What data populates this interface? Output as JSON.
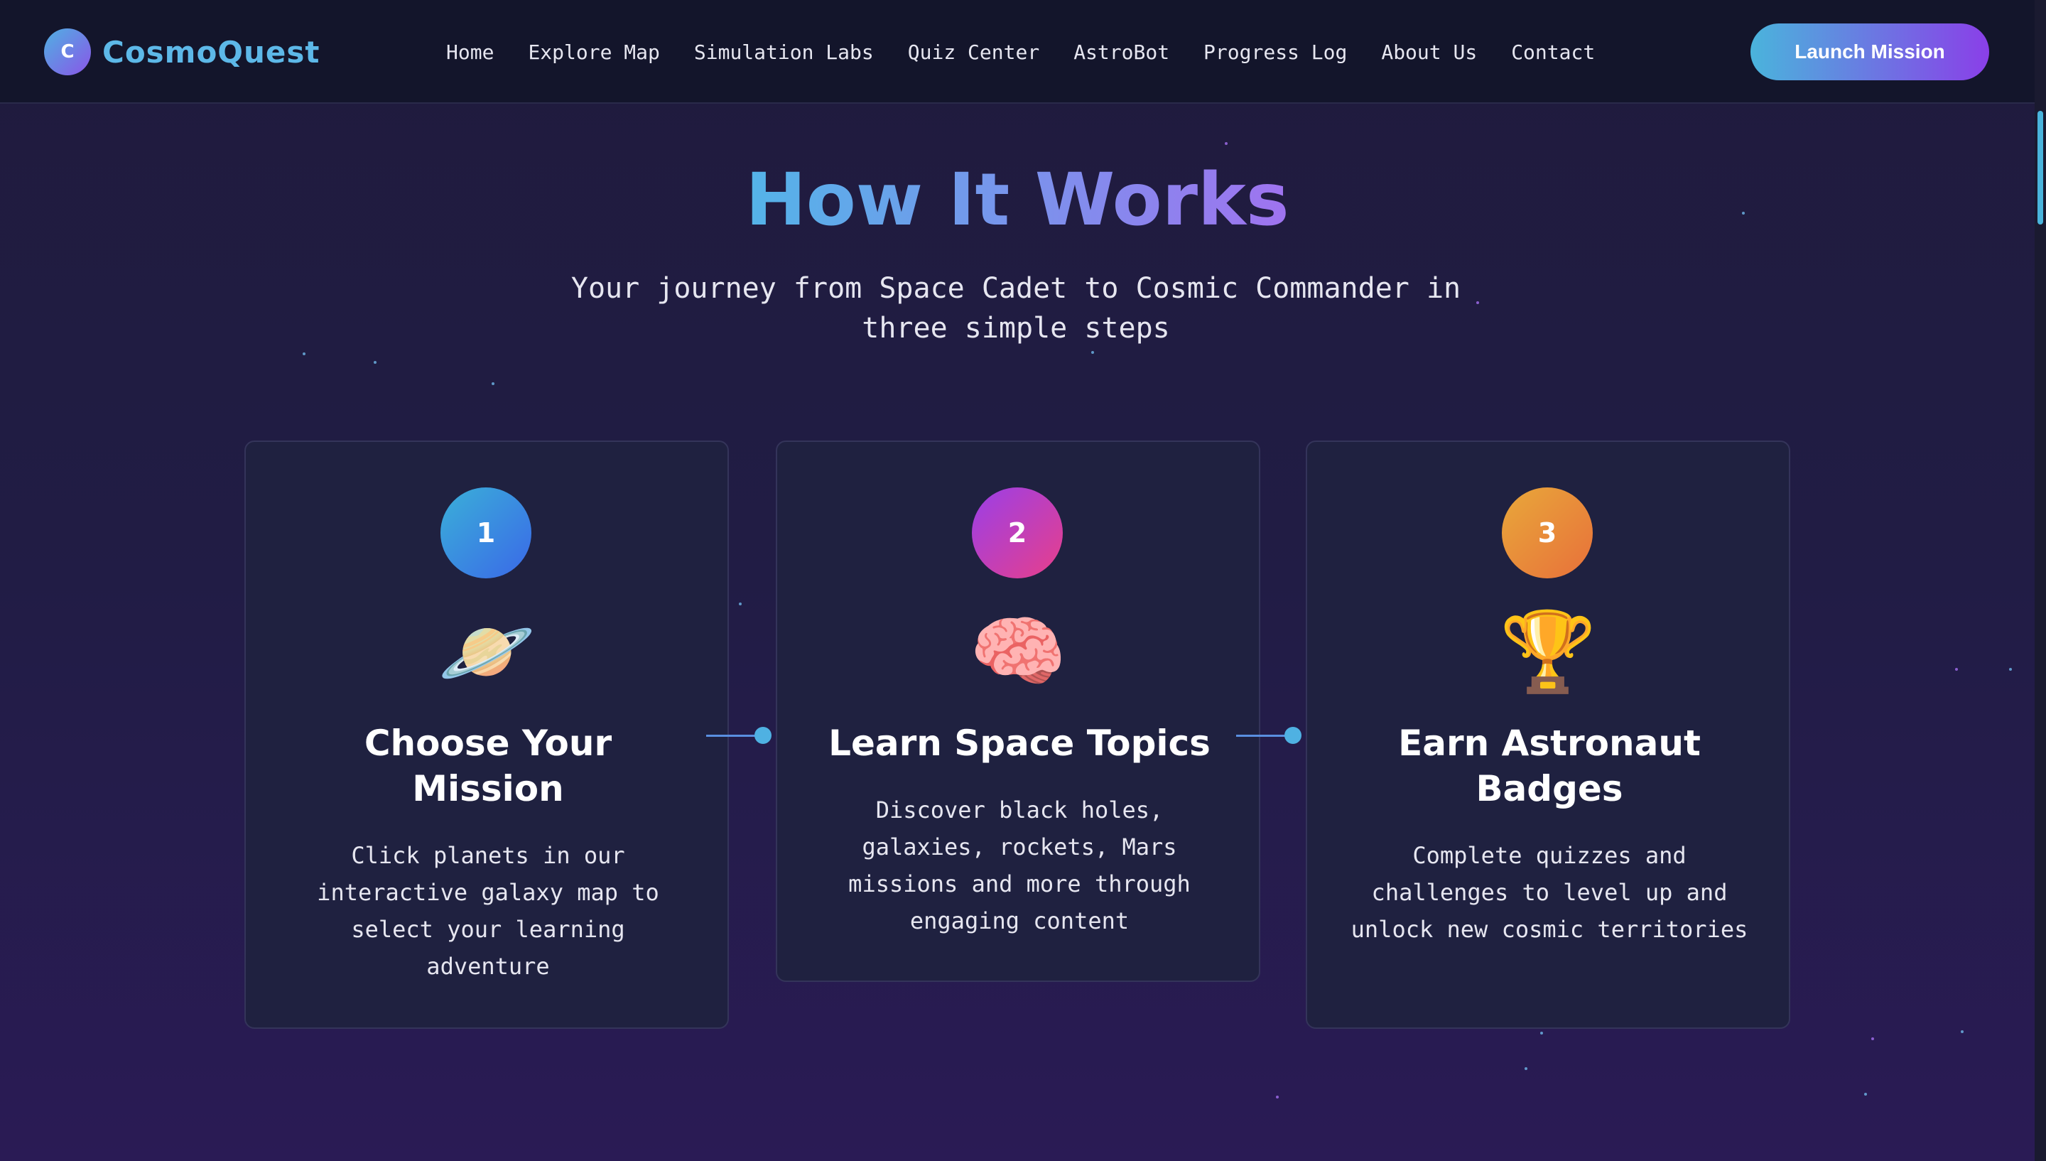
{
  "nav": {
    "brand_initial": "C",
    "brand_name": "CosmoQuest",
    "links": [
      "Home",
      "Explore Map",
      "Simulation Labs",
      "Quiz Center",
      "AstroBot",
      "Progress Log",
      "About Us",
      "Contact"
    ],
    "cta_label": "Launch Mission"
  },
  "hero": {
    "title": "How It Works",
    "subtitle": "Your journey from Space Cadet to Cosmic Commander in three simple steps"
  },
  "steps": [
    {
      "number": "1",
      "emoji": "🪐",
      "icon": "ringed-planet-icon",
      "title": "Choose Your Mission",
      "description": "Click planets in our interactive galaxy map to select your learning adventure",
      "badge_gradient": [
        "#3ab0d8",
        "#3a68e8"
      ]
    },
    {
      "number": "2",
      "emoji": "🧠",
      "icon": "brain-icon",
      "title": "Learn Space Topics",
      "description": "Discover black holes, galaxies, rockets, Mars missions and more through engaging content",
      "badge_gradient": [
        "#9a3fe8",
        "#e83f8a"
      ]
    },
    {
      "number": "3",
      "emoji": "🏆",
      "icon": "trophy-icon",
      "title": "Earn Astronaut Badges",
      "description": "Complete quizzes and challenges to level up and unlock new cosmic territories",
      "badge_gradient": [
        "#e8a83a",
        "#e8703a"
      ]
    }
  ],
  "colors": {
    "accent_blue": "#4fb8e8",
    "accent_purple": "#a46ff0",
    "nav_bg": "#13152b",
    "card_bg": "#1f2140"
  }
}
